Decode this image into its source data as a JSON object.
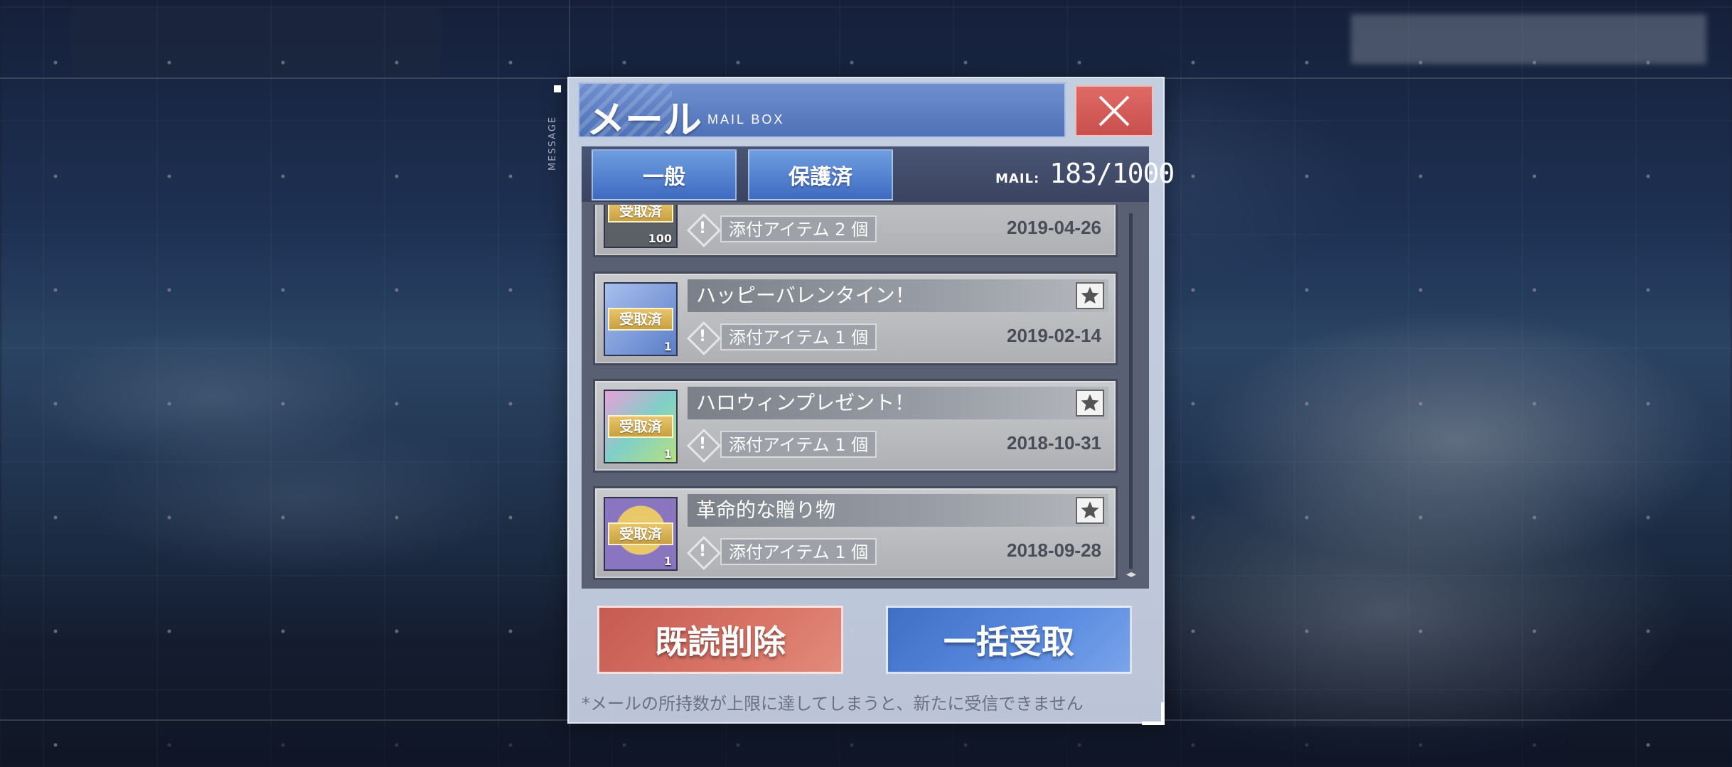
{
  "dialog": {
    "title": "メール",
    "subtitle": "MAIL BOX",
    "side_label": "MESSAGE",
    "close_icon": "close-icon"
  },
  "tabs": [
    {
      "label": "一般",
      "active": true
    },
    {
      "label": "保護済",
      "active": false
    }
  ],
  "mail_counter": {
    "label": "MAIL:",
    "value": "183/1000"
  },
  "mails": [
    {
      "title": "",
      "badge": "受取済",
      "qty": "100",
      "attach": "添付アイテム 2 個",
      "date": "2019-04-26",
      "thumb_color": "#5b5f66",
      "starred": false
    },
    {
      "title": "ハッピーバレンタイン！",
      "badge": "受取済",
      "qty": "1",
      "attach": "添付アイテム 1 個",
      "date": "2019-02-14",
      "thumb_color": "#7f9fd6",
      "starred": false
    },
    {
      "title": "ハロウィンプレゼント！",
      "badge": "受取済",
      "qty": "1",
      "attach": "添付アイテム 1 個",
      "date": "2018-10-31",
      "thumb_color": "#7fc6c8",
      "starred": false
    },
    {
      "title": "革命的な贈り物",
      "badge": "受取済",
      "qty": "1",
      "attach": "添付アイテム 1 個",
      "date": "2018-09-28",
      "thumb_color": "#8a76c0",
      "starred": false
    }
  ],
  "buttons": {
    "delete_read": "既読削除",
    "claim_all": "一括受取"
  },
  "footnote": "*メールの所持数が上限に達してしまうと、新たに受信できません",
  "colors": {
    "title_blue": "#5a7bc0",
    "close_red": "#d55f5c",
    "delete_red": "#d06a5f",
    "claim_blue": "#4f7fd4"
  }
}
